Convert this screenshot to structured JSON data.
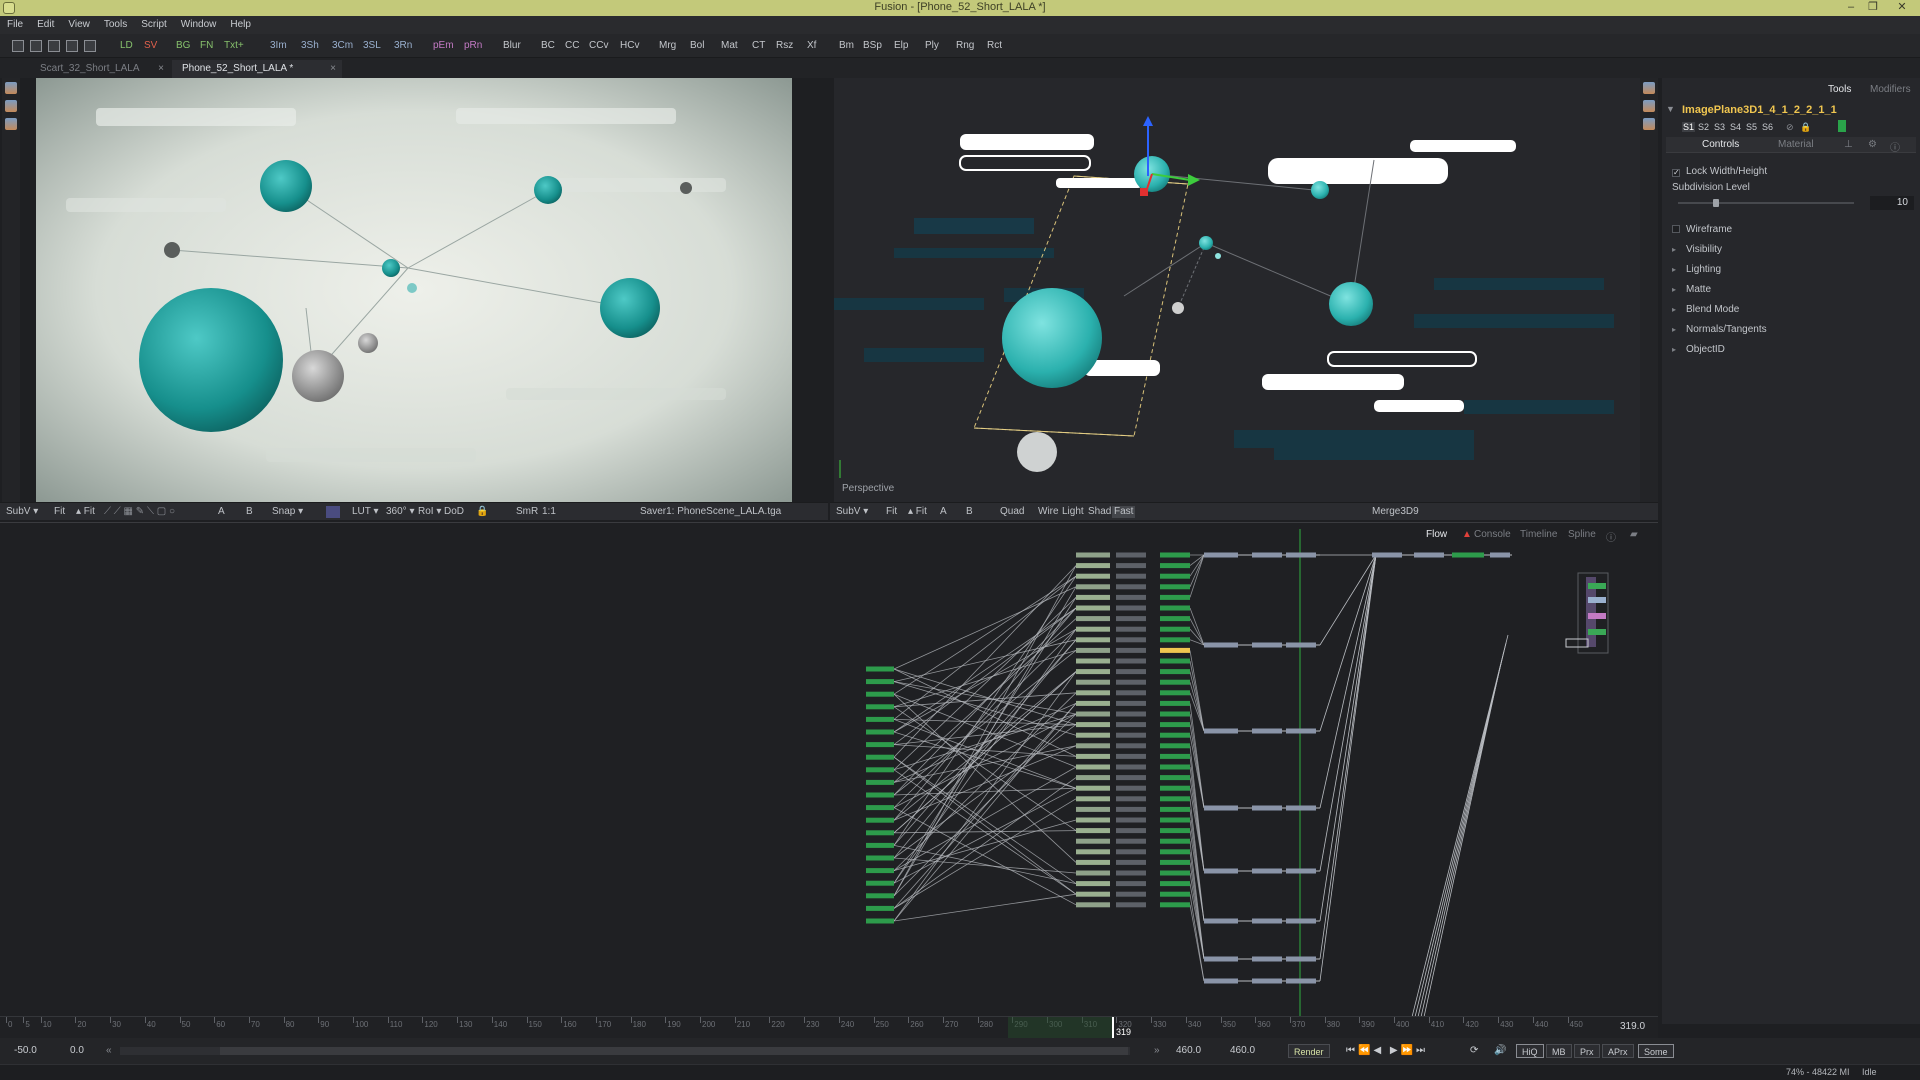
{
  "window": {
    "title": "Fusion - [Phone_52_Short_LALA *]",
    "minimize": "–",
    "restore": "❐",
    "close": "✕"
  },
  "menu": [
    "File",
    "Edit",
    "View",
    "Tools",
    "Script",
    "Window",
    "Help"
  ],
  "toolbar": {
    "buttons": [
      {
        "label": "LD",
        "color": "#86c06c"
      },
      {
        "label": "SV",
        "color": "#e0604c"
      },
      {
        "label": "BG",
        "color": "#86c06c"
      },
      {
        "label": "FN",
        "color": "#86c06c"
      },
      {
        "label": "Txt+",
        "color": "#86c06c"
      },
      {
        "label": "3Im",
        "color": "#9ab0cf"
      },
      {
        "label": "3Sh",
        "color": "#9ab0cf"
      },
      {
        "label": "3Cm",
        "color": "#9ab0cf"
      },
      {
        "label": "3SL",
        "color": "#9ab0cf"
      },
      {
        "label": "3Rn",
        "color": "#9ab0cf"
      },
      {
        "label": "pEm",
        "color": "#c37ac4"
      },
      {
        "label": "pRn",
        "color": "#c37ac4"
      },
      {
        "label": "Blur",
        "color": "#c4c7cc"
      },
      {
        "label": "BC",
        "color": "#c4c7cc"
      },
      {
        "label": "CC",
        "color": "#c4c7cc"
      },
      {
        "label": "CCv",
        "color": "#c4c7cc"
      },
      {
        "label": "HCv",
        "color": "#c4c7cc"
      },
      {
        "label": "Mrg",
        "color": "#c4c7cc"
      },
      {
        "label": "Bol",
        "color": "#c4c7cc"
      },
      {
        "label": "Mat",
        "color": "#c4c7cc"
      },
      {
        "label": "CT",
        "color": "#c4c7cc"
      },
      {
        "label": "Rsz",
        "color": "#c4c7cc"
      },
      {
        "label": "Xf",
        "color": "#c4c7cc"
      },
      {
        "label": "Bm",
        "color": "#c4c7cc"
      },
      {
        "label": "BSp",
        "color": "#c4c7cc"
      },
      {
        "label": "Elp",
        "color": "#c4c7cc"
      },
      {
        "label": "Ply",
        "color": "#c4c7cc"
      },
      {
        "label": "Rng",
        "color": "#c4c7cc"
      },
      {
        "label": "Rct",
        "color": "#c4c7cc"
      }
    ]
  },
  "doc_tabs": [
    {
      "label": "Scart_32_Short_LALA",
      "active": false
    },
    {
      "label": "Phone_52_Short_LALA *",
      "active": true
    }
  ],
  "viewer_left": {
    "bar": [
      "SubV ▾",
      "Fit",
      "▴ Fit",
      "A",
      "B",
      "Snap ▾",
      "LUT ▾",
      "360° ▾",
      "RoI ▾",
      "DoD",
      "SmR",
      "1:1"
    ],
    "tool_name": "Saver1: PhoneScene_LALA.tga"
  },
  "viewer_right": {
    "label": "Perspective",
    "bar": [
      "SubV ▾",
      "Fit",
      "▴ Fit",
      "A",
      "B",
      "Quad",
      "Wire",
      "Light",
      "Shad",
      "Fast"
    ],
    "tool_name": "Merge3D9"
  },
  "inspector": {
    "tabs": [
      "Tools",
      "Modifiers"
    ],
    "tool_name": "ImagePlane3D1_4_1_2_2_1_1",
    "slots": [
      "S1",
      "S2",
      "S3",
      "S4",
      "S5",
      "S6"
    ],
    "subtabs": [
      "Controls",
      "Material"
    ],
    "lock_width_height": {
      "label": "Lock Width/Height",
      "checked": true
    },
    "subdivision": {
      "label": "Subdivision Level",
      "value": "10",
      "fraction": 0.2
    },
    "wireframe": {
      "label": "Wireframe",
      "checked": false
    },
    "sections": [
      "Visibility",
      "Lighting",
      "Matte",
      "Blend Mode",
      "Normals/Tangents",
      "ObjectID"
    ]
  },
  "flow_tabs": [
    {
      "label": "Flow",
      "active": true
    },
    {
      "label": "Console",
      "active": false,
      "warning": true
    },
    {
      "label": "Timeline",
      "active": false
    },
    {
      "label": "Spline",
      "active": false
    }
  ],
  "time": {
    "ruler_ticks": [
      "0",
      "5",
      "10",
      "20",
      "30",
      "40",
      "50",
      "60",
      "70",
      "80",
      "90",
      "100",
      "110",
      "120",
      "130",
      "140",
      "150",
      "160",
      "170",
      "180",
      "190",
      "200",
      "210",
      "220",
      "230",
      "240",
      "250",
      "260",
      "270",
      "280",
      "290",
      "300",
      "310",
      "320",
      "330",
      "340",
      "350",
      "360",
      "370",
      "380",
      "390",
      "400",
      "410",
      "420",
      "430",
      "440",
      "450"
    ],
    "current_frame": "319",
    "end_display": "319.0",
    "global_start": "-50.0",
    "render_start": "0.0",
    "render_end": "460.0",
    "global_end": "460.0",
    "render_label": "Render",
    "quality_buttons": [
      "HiQ",
      "MB",
      "Prx",
      "APrx",
      "Some"
    ]
  },
  "status": {
    "memory": "74% - 48422 MI",
    "state": "Idle"
  }
}
